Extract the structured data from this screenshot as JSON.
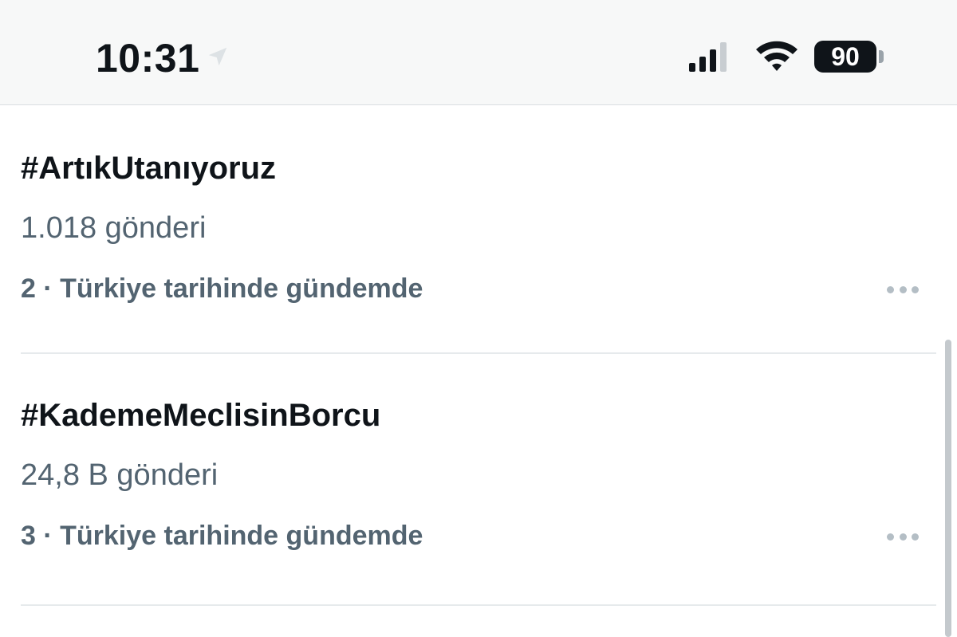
{
  "status_bar": {
    "time": "10:31",
    "battery_level": "90",
    "icons": [
      "location-arrow-icon",
      "cellular-signal-icon",
      "wifi-icon",
      "battery-icon"
    ]
  },
  "trends": [
    {
      "hashtag": "#ArtıkUtanıyoruz",
      "post_count": "1.018 gönderi",
      "context": "2 · Türkiye tarihinde gündemde"
    },
    {
      "hashtag": "#KademeMeclisinBorcu",
      "post_count": "24,8 B gönderi",
      "context": "3 · Türkiye tarihinde gündemde"
    }
  ],
  "colors": {
    "primary_text": "#0f1419",
    "secondary_text": "#536471",
    "divider": "#e6eaec"
  }
}
